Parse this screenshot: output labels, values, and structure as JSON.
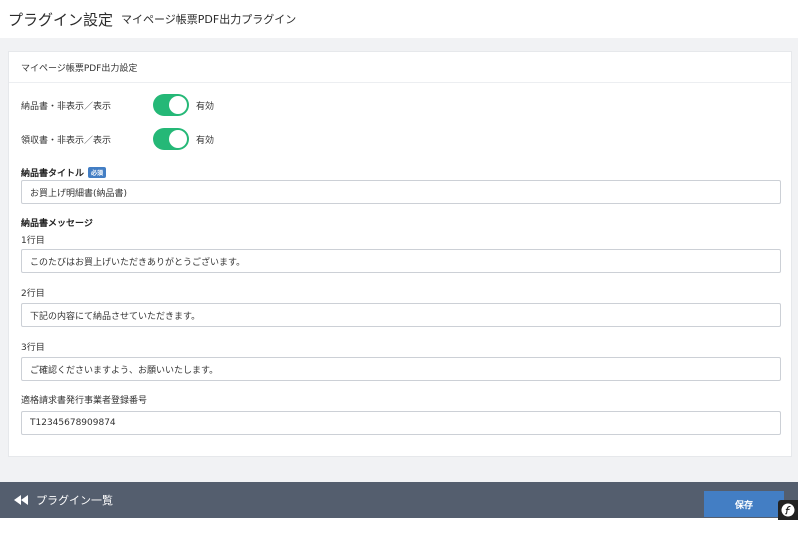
{
  "header": {
    "title": "プラグイン設定",
    "subtitle": "マイページ帳票PDF出力プラグイン"
  },
  "card": {
    "title": "マイページ帳票PDF出力設定",
    "toggles": [
      {
        "label": "納品書・非表示／表示",
        "state": "有効",
        "on": true
      },
      {
        "label": "領収書・非表示／表示",
        "state": "有効",
        "on": true
      }
    ],
    "invoice_title": {
      "label": "納品書タイトル",
      "badge": "必須",
      "value": "お買上げ明細書(納品書)"
    },
    "message": {
      "label": "納品書メッセージ",
      "lines": [
        {
          "label": "1行目",
          "value": "このたびはお買上げいただきありがとうございます。"
        },
        {
          "label": "2行目",
          "value": "下記の内容にて納品させていただきます。"
        },
        {
          "label": "3行目",
          "value": "ご確認くださいますよう、お願いいたします。"
        }
      ]
    },
    "registration": {
      "label": "適格請求書発行事業者登録番号",
      "value": "T12345678909874"
    }
  },
  "footer": {
    "back_label": "プラグイン一覧",
    "save_label": "保存"
  },
  "colors": {
    "toggle_on": "#25b877",
    "primary": "#437ec4",
    "footer_bg": "#545e6e",
    "page_bg": "#f1f2f4"
  }
}
